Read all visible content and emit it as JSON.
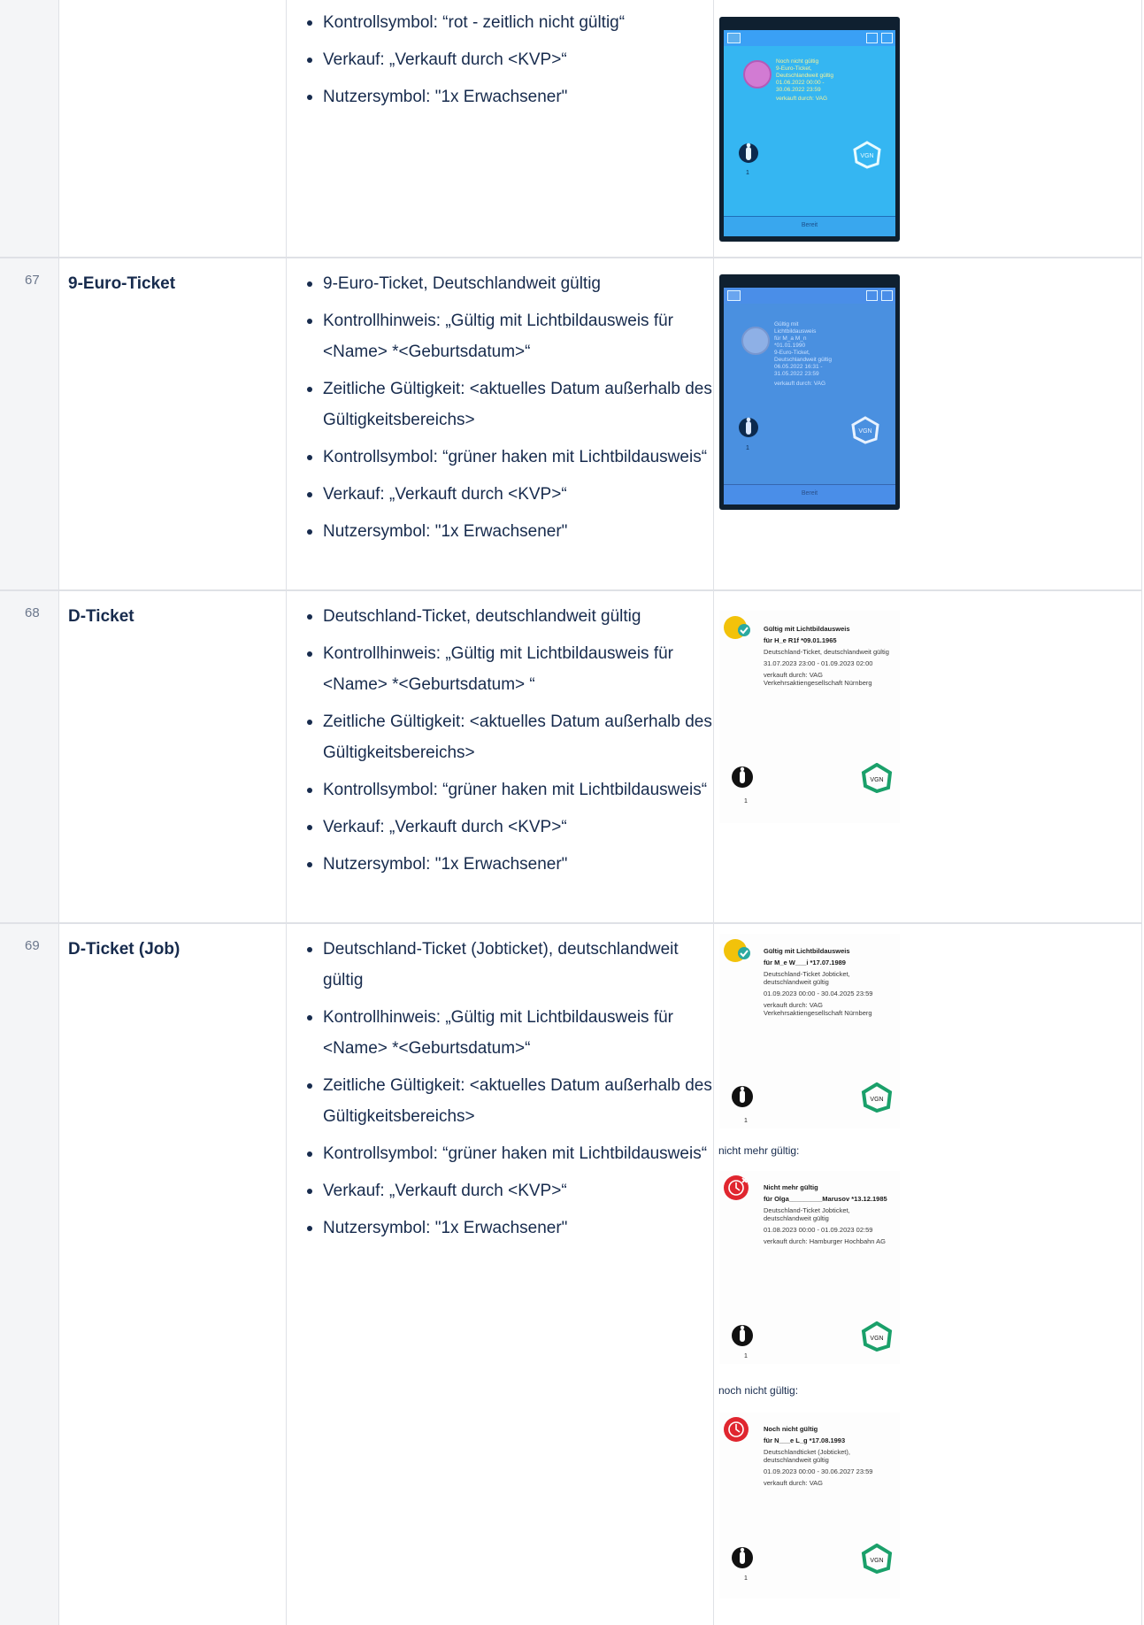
{
  "rows": {
    "r66": {
      "bullets": [
        "Kontrollsymbol: “rot - zeitlich nicht gültig“",
        "Verkauf: „Verkauft durch <KVP>“",
        "Nutzersymbol: \"1x Erwachsener\""
      ],
      "screen": {
        "title": "Noch nicht gültig",
        "lines": [
          "9-Euro-Ticket,",
          "Deutschlandweit gültig",
          "01.06.2022 00:00 -",
          "30.06.2022 23:59"
        ],
        "sold": "verkauft durch: VAG",
        "count": "1",
        "logo": "VGN",
        "status": "Bereit"
      }
    },
    "r67": {
      "number": "67",
      "name": "9-Euro-Ticket",
      "bullets": [
        "9-Euro-Ticket, Deutschlandweit gültig",
        "Kontrollhinweis: „Gültig mit Lichtbildausweis für <Name> *<Geburtsdatum>“",
        "Zeitliche Gültigkeit: <aktuelles Datum außerhalb des Gültigkeitsbereichs>",
        "Kontrollsymbol: “grüner haken mit Lichtbildausweis“",
        "Verkauf: „Verkauft durch <KVP>“",
        "Nutzersymbol: \"1x Erwachsener\""
      ],
      "screen": {
        "lines": [
          "Gültig mit",
          "Lichtbildausweis",
          "für M_a M_n",
          "*01.01.1990",
          "9-Euro-Ticket,",
          "Deutschlandweit gültig",
          "06.05.2022 16:31 -",
          "31.05.2022 23:59"
        ],
        "sold": "verkauft durch: VAG",
        "count": "1",
        "logo": "VGN",
        "status": "Bereit"
      }
    },
    "r68": {
      "number": "68",
      "name": "D-Ticket",
      "bullets": [
        "Deutschland-Ticket, deutschlandweit gültig",
        "Kontrollhinweis: „Gültig mit Lichtbildausweis für <Name> *<Geburtsdatum> “",
        "Zeitliche Gültigkeit: <aktuelles Datum außerhalb des Gültigkeitsbereichs>",
        "Kontrollsymbol: “grüner haken mit Lichtbildausweis“",
        "Verkauf: „Verkauft durch <KVP>“",
        "Nutzersymbol: \"1x Erwachsener\""
      ],
      "screen": {
        "title": "Gültig mit Lichtbildausweis",
        "holder": "für H_e R1f *09.01.1965",
        "ticket": "Deutschland-Ticket, deutschlandweit gültig",
        "validity": "31.07.2023 23:00 - 01.09.2023 02:00",
        "sold": "verkauft durch: VAG Verkehrsaktiengesellschaft Nürnberg",
        "count": "1",
        "logo": "VGN"
      }
    },
    "r69": {
      "number": "69",
      "name": "D-Ticket (Job)",
      "bullets": [
        "Deutschland-Ticket (Jobticket), deutschlandweit gültig",
        "Kontrollhinweis: „Gültig mit Lichtbildausweis für <Name> *<Geburtsdatum>“",
        "Zeitliche Gültigkeit: <aktuelles Datum außerhalb des Gültigkeitsbereichs>",
        "Kontrollsymbol: “grüner haken mit Lichtbildausweis“",
        "Verkauf: „Verkauft durch <KVP>“",
        "Nutzersymbol: \"1x Erwachsener\""
      ],
      "screens": [
        {
          "title": "Gültig mit Lichtbildausweis",
          "holder": "für M_e W___i *17.07.1989",
          "ticket": "Deutschland-Ticket Jobticket, deutschlandweit gültig",
          "validity": "01.09.2023 00:00 - 30.04.2025 23:59",
          "sold": "verkauft durch: VAG Verkehrsaktiengesellschaft Nürnberg",
          "count": "1",
          "logo": "VGN"
        },
        {
          "caption": "nicht mehr gültig:",
          "title": "Nicht mehr gültig",
          "holder": "für Olga_________Marusov *13.12.1985",
          "ticket": "Deutschland-Ticket Jobticket, deutschlandweit gültig",
          "validity": "01.08.2023 00:00 - 01.09.2023 02:59",
          "sold": "verkauft durch: Hamburger Hochbahn AG",
          "count": "1",
          "logo": "VGN"
        },
        {
          "caption": "noch nicht gültig:",
          "title": "Noch nicht gültig",
          "holder": "für N___e L_g *17.08.1993",
          "ticket": "Deutschlandticket (Jobticket), deutschlandweit gültig",
          "validity": "01.09.2023 00:00 - 30.06.2027 23:59",
          "sold": "verkauft durch: VAG",
          "count": "1",
          "logo": "VGN"
        }
      ]
    }
  },
  "colors": {
    "border": "#dfe1e6",
    "number_col_bg": "#f4f5f7",
    "text": "#172b4d",
    "device_screen": "#35b6f2",
    "seal_yellow": "#f2c20a",
    "seal_red": "#e0262f",
    "vgn_green": "#1aa06a"
  },
  "icons": [
    "person-icon",
    "vgn-logo",
    "photo-id-seal-icon",
    "invalid-seal-icon",
    "close-icon",
    "menu-icon"
  ]
}
